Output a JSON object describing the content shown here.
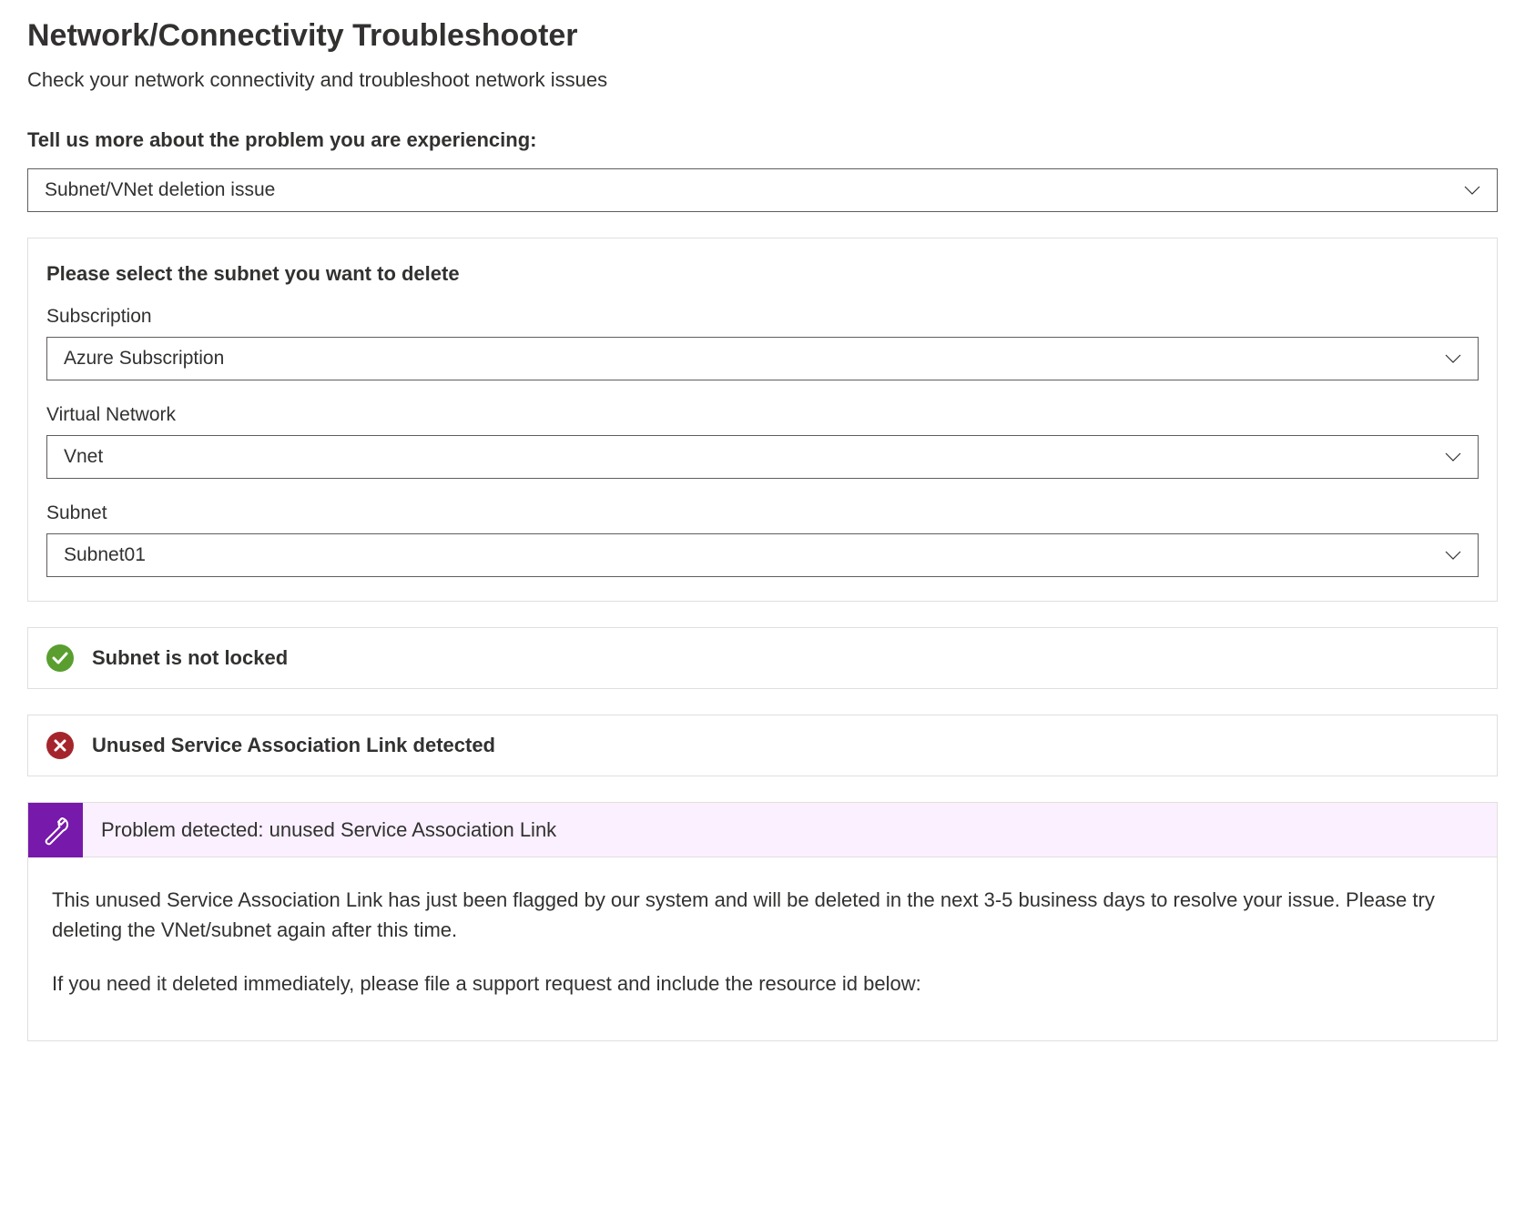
{
  "header": {
    "title": "Network/Connectivity Troubleshooter",
    "subtitle": "Check your network connectivity and troubleshoot network issues"
  },
  "problem_section": {
    "label": "Tell us more about the problem you are experiencing:",
    "selected": "Subnet/VNet deletion issue"
  },
  "subnet_form": {
    "title": "Please select the subnet you want to delete",
    "subscription": {
      "label": "Subscription",
      "value": "Azure Subscription"
    },
    "vnet": {
      "label": "Virtual Network",
      "value": "Vnet"
    },
    "subnet": {
      "label": "Subnet",
      "value": "Subnet01"
    }
  },
  "statuses": {
    "locked": "Subnet is not locked",
    "sal": "Unused Service Association Link detected"
  },
  "problem_detail": {
    "header": "Problem detected: unused Service Association Link",
    "body1": "This unused Service Association Link has just been flagged by our system and will be deleted in the next 3-5 business days to resolve your issue. Please try deleting the VNet/subnet again after this time.",
    "body2": "If you need it deleted immediately, please file a support request and include the resource id below:"
  }
}
